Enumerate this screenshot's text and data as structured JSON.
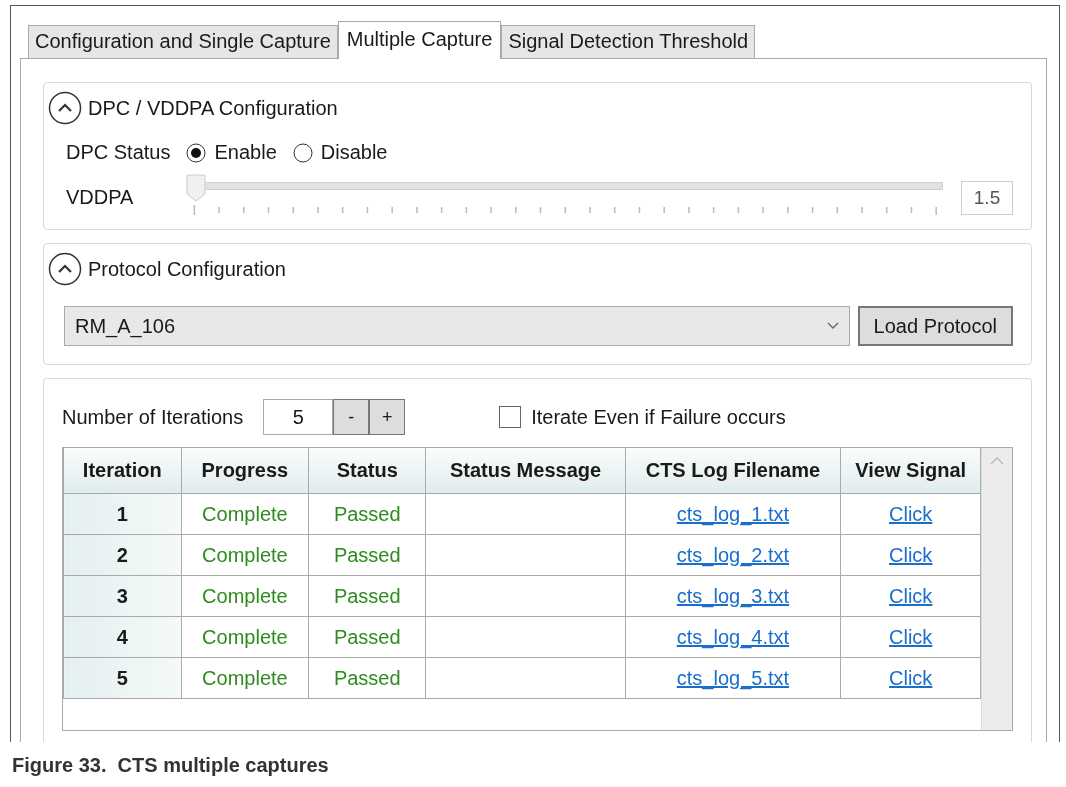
{
  "tabs": [
    {
      "label": "Configuration and Single Capture",
      "selected": false
    },
    {
      "label": "Multiple Capture",
      "selected": true
    },
    {
      "label": "Signal Detection Threshold",
      "selected": false
    }
  ],
  "dpc_group": {
    "title": "DPC / VDDPA Configuration",
    "expanded": true,
    "status_label": "DPC Status",
    "options": [
      {
        "label": "Enable",
        "selected": true
      },
      {
        "label": "Disable",
        "selected": false
      }
    ],
    "vddpa_label": "VDDPA",
    "vddpa": {
      "level": 0,
      "reading": "1.5"
    }
  },
  "protocol_group": {
    "title": "Protocol Configuration",
    "expanded": true,
    "protocol": "RM_A_106",
    "load_button": "Load Protocol"
  },
  "iterations": {
    "label": "Number of Iterations",
    "value": "5",
    "decrement": "-",
    "increment": "+",
    "iterate_on_failure": {
      "label": "Iterate Even if Failure occurs",
      "checked": false
    }
  },
  "table": {
    "columns": [
      "Iteration",
      "Progress",
      "Status",
      "Status Message",
      "CTS Log Filename",
      "View Signal"
    ],
    "rows": [
      {
        "iteration": "1",
        "progress": "Complete",
        "status": "Passed",
        "log": "cts_log_1.txt",
        "view": "Click"
      },
      {
        "iteration": "2",
        "progress": "Complete",
        "status": "Passed",
        "log": "cts_log_2.txt",
        "view": "Click"
      },
      {
        "iteration": "3",
        "progress": "Complete",
        "status": "Passed",
        "log": "cts_log_3.txt",
        "view": "Click"
      },
      {
        "iteration": "4",
        "progress": "Complete",
        "status": "Passed",
        "log": "cts_log_4.txt",
        "view": "Click"
      },
      {
        "iteration": "5",
        "progress": "Complete",
        "status": "Passed",
        "log": "cts_log_5.txt",
        "view": "Click"
      }
    ]
  },
  "caption": "Figure 33.  CTS multiple captures"
}
